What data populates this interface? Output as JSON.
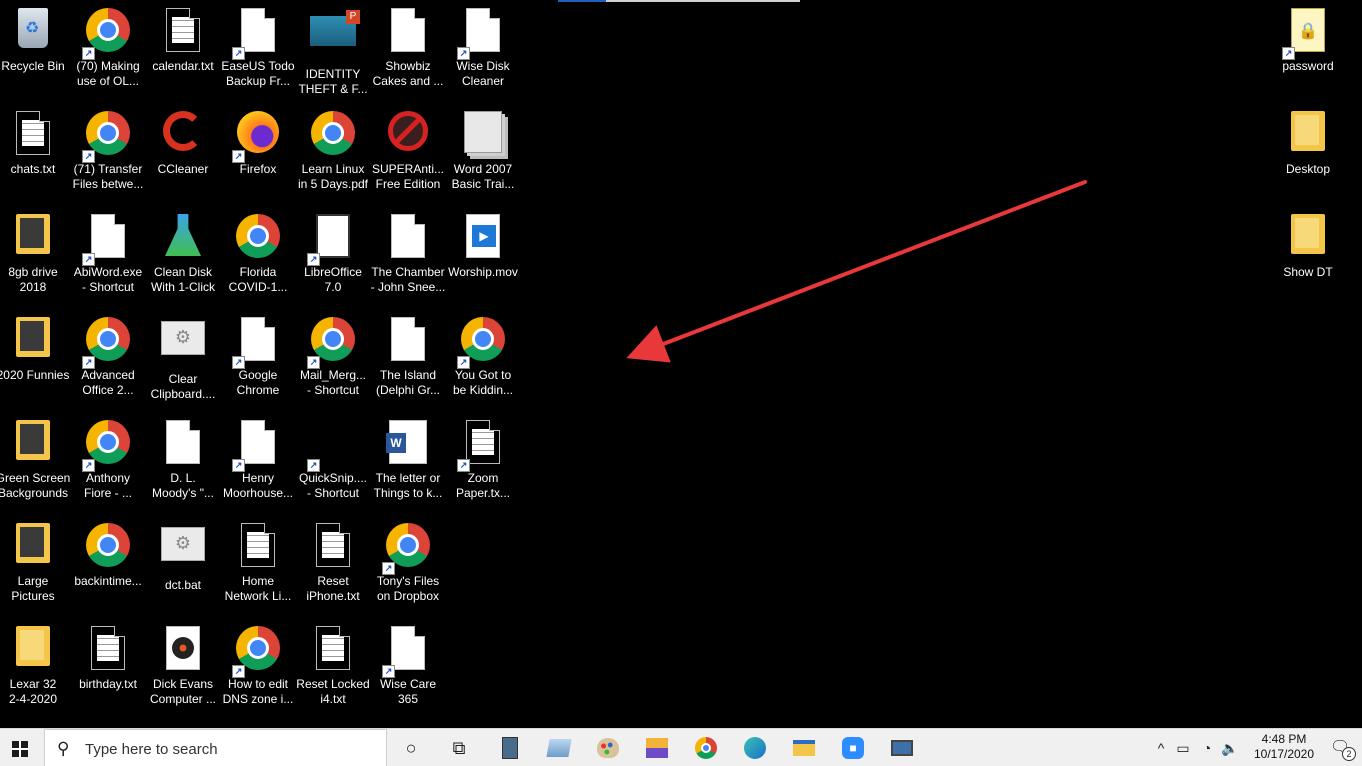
{
  "desktop_icons": [
    {
      "label": "Recycle Bin"
    },
    {
      "label": "(70) Making\nuse of OL..."
    },
    {
      "label": "calendar.txt"
    },
    {
      "label": "EaseUS Todo\nBackup Fr..."
    },
    {
      "label": "IDENTITY\nTHEFT & F..."
    },
    {
      "label": "Showbiz\nCakes and ..."
    },
    {
      "label": "Wise Disk\nCleaner"
    },
    {
      "label": "chats.txt"
    },
    {
      "label": "(71) Transfer\nFiles betwe..."
    },
    {
      "label": "CCleaner"
    },
    {
      "label": "Firefox"
    },
    {
      "label": "Learn Linux\nin 5 Days.pdf"
    },
    {
      "label": "SUPERAnti...\nFree Edition"
    },
    {
      "label": "Word 2007\nBasic Trai..."
    },
    {
      "label": "8gb  drive\n2018"
    },
    {
      "label": "AbiWord.exe\n- Shortcut"
    },
    {
      "label": "Clean Disk\nWith 1-Click"
    },
    {
      "label": "Florida\nCOVID-1..."
    },
    {
      "label": "LibreOffice\n7.0"
    },
    {
      "label": "The Chamber\n- John Snee..."
    },
    {
      "label": "Worship.mov"
    },
    {
      "label": "2020 Funnies"
    },
    {
      "label": "Advanced\nOffice 2..."
    },
    {
      "label": "Clear\nClipboard...."
    },
    {
      "label": "Google\nChrome"
    },
    {
      "label": "Mail_Merg...\n- Shortcut"
    },
    {
      "label": "The Island\n(Delphi Gr..."
    },
    {
      "label": "You Got to\nbe Kiddin..."
    },
    {
      "label": "Green Screen\nBackgrounds"
    },
    {
      "label": "Anthony\nFiore - ..."
    },
    {
      "label": "D. L.\nMoody's \"..."
    },
    {
      "label": "Henry\nMoorhouse..."
    },
    {
      "label": "QuickSnip....\n- Shortcut"
    },
    {
      "label": "The letter or\nThings to k..."
    },
    {
      "label": "Zoom\nPaper.tx..."
    },
    {
      "label": "Large\nPictures"
    },
    {
      "label": "backintime..."
    },
    {
      "label": "dct.bat"
    },
    {
      "label": "Home\nNetwork Li..."
    },
    {
      "label": "Reset\niPhone.txt"
    },
    {
      "label": "Tony's Files\non Dropbox"
    },
    {
      "label": "Lexar 32\n2-4-2020"
    },
    {
      "label": "birthday.txt"
    },
    {
      "label": "Dick Evans\nComputer ..."
    },
    {
      "label": "How to edit\nDNS zone i..."
    },
    {
      "label": "Reset Locked\ni4.txt"
    },
    {
      "label": "Wise Care\n365"
    },
    {
      "label": "password"
    },
    {
      "label": "Desktop"
    },
    {
      "label": "Show DT"
    }
  ],
  "annotation": {
    "color": "#e8383a"
  },
  "taskbar": {
    "search_placeholder": "Type here to search",
    "clock_time": "4:48 PM",
    "clock_date": "10/17/2020",
    "notification_count": "2",
    "pinned_apps": [
      "task-view",
      "calculator",
      "notepad",
      "paint",
      "network-tool",
      "chrome",
      "edge",
      "file-explorer",
      "zoom",
      "remote-desktop"
    ]
  }
}
